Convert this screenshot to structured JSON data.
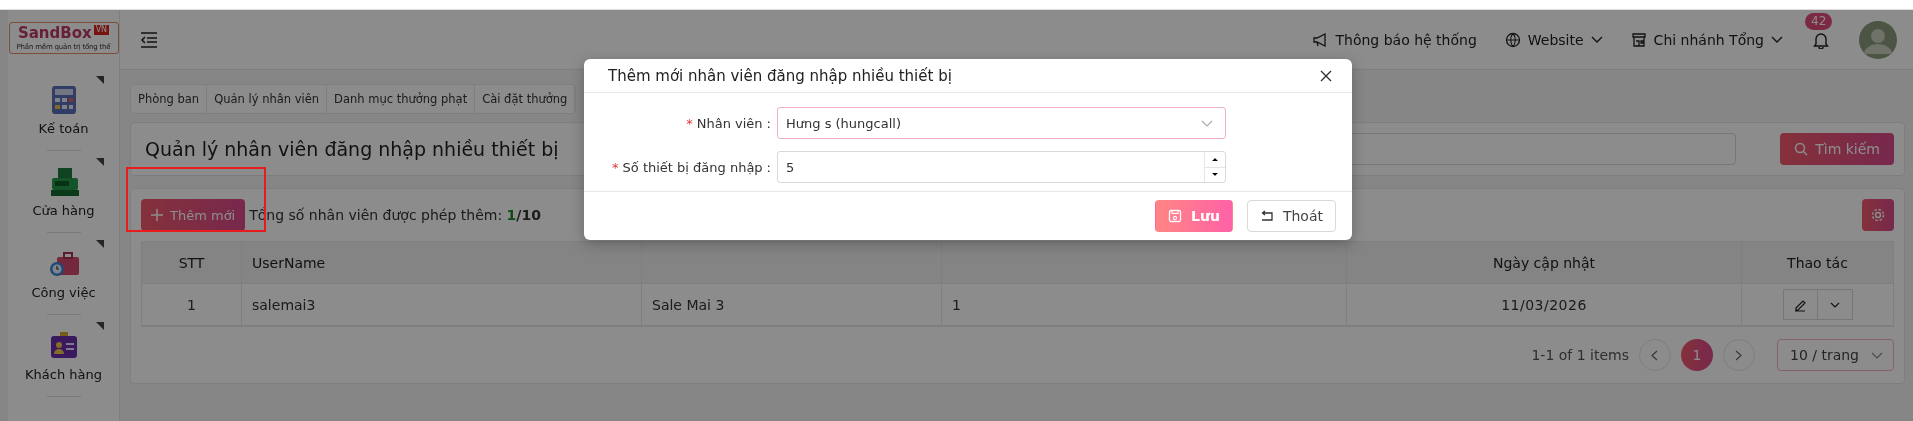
{
  "logo": {
    "name": "SandBox",
    "badge": "VN",
    "tagline": "Phần mềm quản trị tổng thể"
  },
  "sidebar": {
    "items": [
      {
        "label": "Kế toán",
        "has_submenu": true
      },
      {
        "label": "Cửa hàng",
        "has_submenu": true
      },
      {
        "label": "Công việc",
        "has_submenu": true
      },
      {
        "label": "Khách hàng",
        "has_submenu": true
      }
    ]
  },
  "header": {
    "items": [
      {
        "label": "Thông báo hệ thống",
        "kind": "notice"
      },
      {
        "label": "Website",
        "kind": "globe"
      },
      {
        "label": "Chi nhánh Tổng",
        "kind": "store"
      }
    ],
    "notification_count": "42"
  },
  "tabs": [
    {
      "label": "Phòng ban",
      "selected": false
    },
    {
      "label": "Quản lý nhân viên",
      "selected": false
    },
    {
      "label": "Danh mục thưởng phạt",
      "selected": false
    },
    {
      "label": "Cài đặt thưởng",
      "selected": false
    }
  ],
  "page_title": "Quản lý nhân viên đăng nhập nhiều thiết bị",
  "search_button": "Tìm kiếm",
  "add_button": "Thêm mới",
  "quota": {
    "label": "Tổng số nhân viên được phép thêm:",
    "used": "1",
    "total": "/10"
  },
  "table": {
    "columns": [
      "STT",
      "UserName",
      "",
      "",
      "Ngày cập nhật",
      "Thao tác"
    ],
    "rows": [
      {
        "cells": [
          "1",
          "salemai3",
          "Sale Mai 3",
          "1",
          "11/03/2026"
        ]
      }
    ]
  },
  "pagination": {
    "summary": "1-1 of 1 items",
    "pages": [
      {
        "label": "1",
        "selected": true
      }
    ],
    "page_size": "10 / trang"
  },
  "modal": {
    "title": "Thêm mới nhân viên đăng nhập nhiều thiết bị",
    "fields": [
      {
        "required_mark": "*",
        "label": "Nhân viên",
        "colon": ":",
        "kind": "select",
        "value": "Hưng s (hungcall)"
      },
      {
        "required_mark": "*",
        "label": "Số thiết bị đăng nhập",
        "colon": ":",
        "kind": "number",
        "value": "5"
      }
    ],
    "buttons": [
      {
        "label": "Lưu",
        "kind": "primary"
      },
      {
        "label": "Thoát",
        "kind": "default"
      }
    ]
  }
}
